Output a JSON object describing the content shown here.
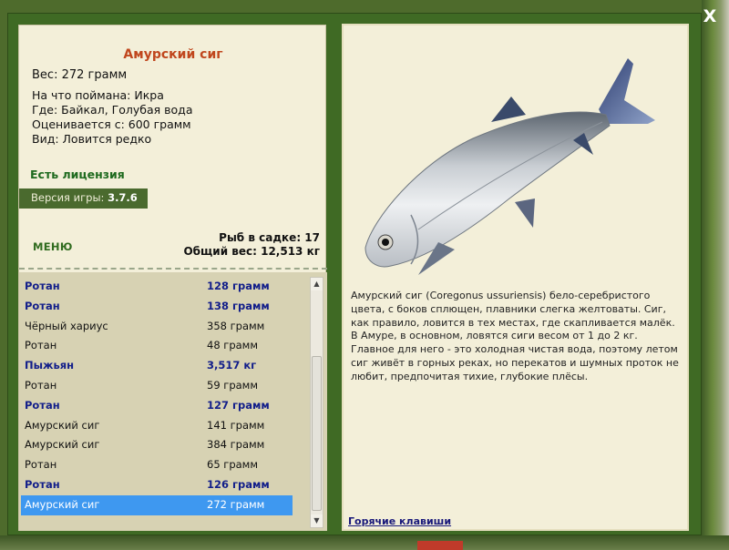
{
  "window": {
    "close_label": "X"
  },
  "fish": {
    "title": "Амурский сиг",
    "weight_line": "Вес: 272 грамм",
    "bait_line": "На что поймана: Икра",
    "location_line": "Где: Байкал, Голубая вода",
    "valued_line": "Оценивается с: 600 грамм",
    "kind_line": "Вид: Ловится редко"
  },
  "license": "Есть лицензия",
  "version": {
    "label": "Версия игры:",
    "value": "3.7.6"
  },
  "menu_label": "МЕНЮ",
  "keepnet": {
    "count_line": "Рыб в садке: 17",
    "total_line": "Общий вес: 12,513 кг"
  },
  "catch_list": [
    {
      "name": "Ротан",
      "weight": "128 грамм",
      "bold": true,
      "selected": false
    },
    {
      "name": "Ротан",
      "weight": "138 грамм",
      "bold": true,
      "selected": false
    },
    {
      "name": "Чёрный хариус",
      "weight": "358 грамм",
      "bold": false,
      "selected": false
    },
    {
      "name": "Ротан",
      "weight": "48 грамм",
      "bold": false,
      "selected": false
    },
    {
      "name": "Пыжьян",
      "weight": "3,517 кг",
      "bold": true,
      "selected": false
    },
    {
      "name": "Ротан",
      "weight": "59 грамм",
      "bold": false,
      "selected": false
    },
    {
      "name": "Ротан",
      "weight": "127 грамм",
      "bold": true,
      "selected": false
    },
    {
      "name": "Амурский сиг",
      "weight": "141 грамм",
      "bold": false,
      "selected": false
    },
    {
      "name": "Амурский сиг",
      "weight": "384 грамм",
      "bold": false,
      "selected": false
    },
    {
      "name": "Ротан",
      "weight": "65 грамм",
      "bold": false,
      "selected": false
    },
    {
      "name": "Ротан",
      "weight": "126 грамм",
      "bold": true,
      "selected": false
    },
    {
      "name": "Амурский сиг",
      "weight": "272 грамм",
      "bold": false,
      "selected": true
    }
  ],
  "description": "Амурский сиг (Coregonus ussuriensis) бело-серебристого цвета, с боков сплющен, плавники слегка желтоваты. Сиг, как правило, ловится в тех местах, где скапливается малёк. В Амуре, в основном, ловятся сиги весом от 1 до 2 кг. Главное для него - это холодная чистая вода, поэтому летом сиг живёт в горных реках, но перекатов и шумных проток не любит, предпочитая тихие, глубокие плёсы.",
  "hotkeys_label": "Горячие клавиши",
  "colors": {
    "panel_bg": "#f3efd9",
    "frame_green": "#3f6a24",
    "title_orange": "#c0461d",
    "license_green": "#1e6a1e",
    "list_bold_blue": "#121e8a",
    "selection_blue": "#3e98f0"
  }
}
